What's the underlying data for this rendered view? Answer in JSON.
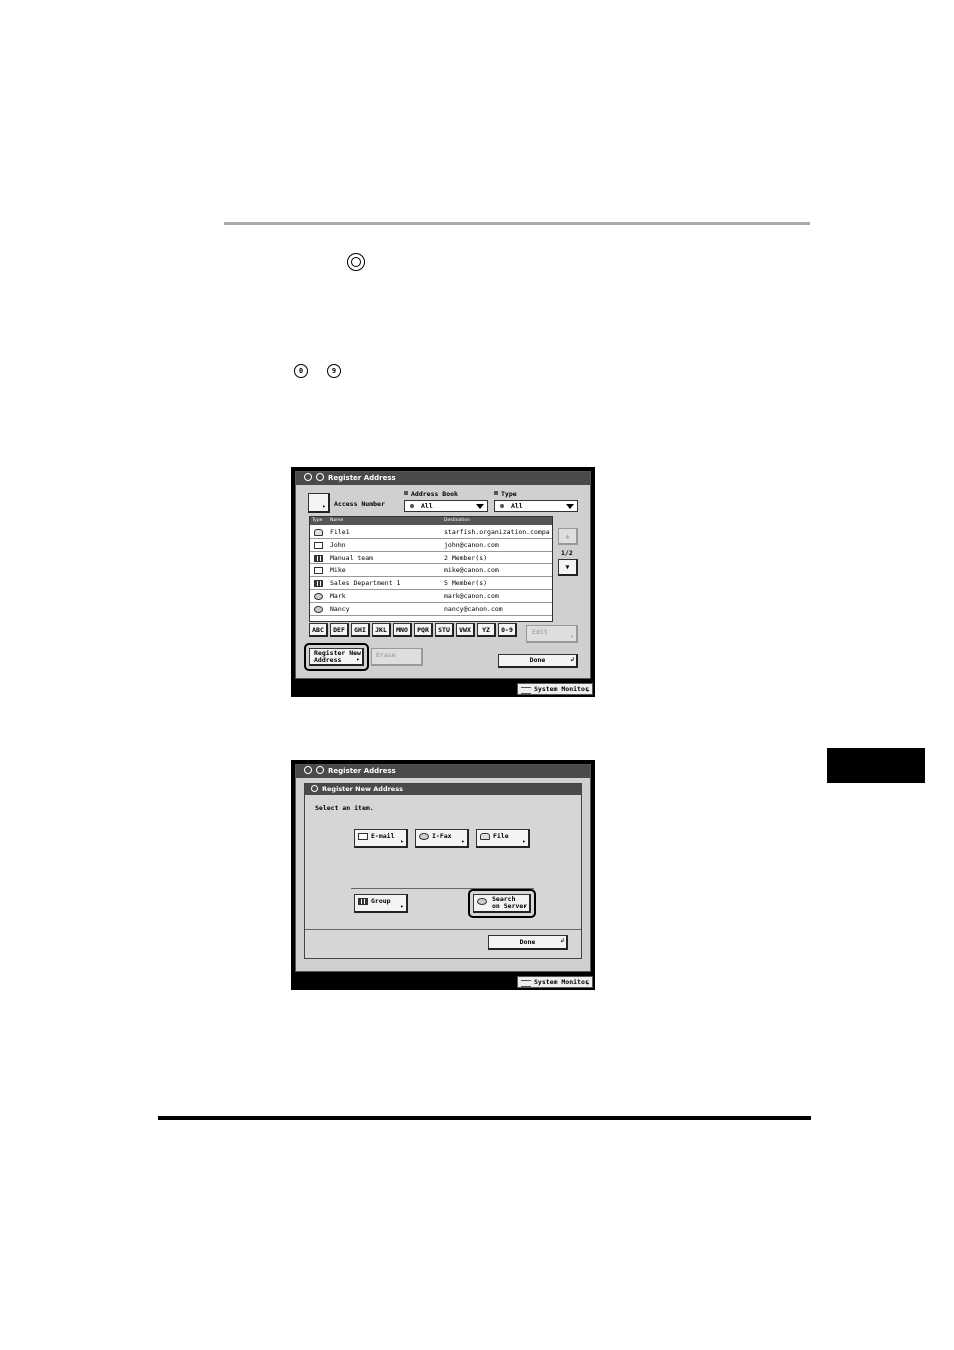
{
  "screen1": {
    "title": "Register Address",
    "access_number": "Access Number",
    "address_book_label": "Address Book",
    "address_book_value": "All",
    "type_label": "Type",
    "type_value": "All",
    "col_type": "Type",
    "col_name": "Name",
    "col_destination": "Destination",
    "rows": [
      {
        "icon": "file-icon",
        "name": "File1",
        "dest": "starfish.organization.compa"
      },
      {
        "icon": "email-icon",
        "name": "John",
        "dest": "john@canon.com"
      },
      {
        "icon": "group-icon",
        "name": "Manual team",
        "dest": "2 Member(s)"
      },
      {
        "icon": "email-icon",
        "name": "Mike",
        "dest": "mike@canon.com"
      },
      {
        "icon": "group-icon",
        "name": "Sales Department 1",
        "dest": "5 Member(s)"
      },
      {
        "icon": "ifax-icon",
        "name": "Mark",
        "dest": "mark@canon.com"
      },
      {
        "icon": "ifax-icon",
        "name": "Nancy",
        "dest": "nancy@canon.com"
      }
    ],
    "page": "1/2",
    "alpha": [
      "ABC",
      "DEF",
      "GHI",
      "JKL",
      "MNO",
      "PQR",
      "STU",
      "VWX",
      "YZ",
      "0-9"
    ],
    "edit": "Edit",
    "register_new_1": "Register New",
    "register_new_2": "Address",
    "erase": "Erase",
    "done": "Done",
    "system_monitor": "System Monitor"
  },
  "screen2": {
    "title": "Register Address",
    "dialog_title": "Register New Address",
    "prompt": "Select an item.",
    "email": "E-mail",
    "ifax": "I-Fax",
    "file": "File",
    "group": "Group",
    "search_1": "Search",
    "search_2": "on Server",
    "done": "Done",
    "system_monitor": "System Monitor"
  },
  "keys": {
    "key_a": "0",
    "key_b": "9"
  }
}
